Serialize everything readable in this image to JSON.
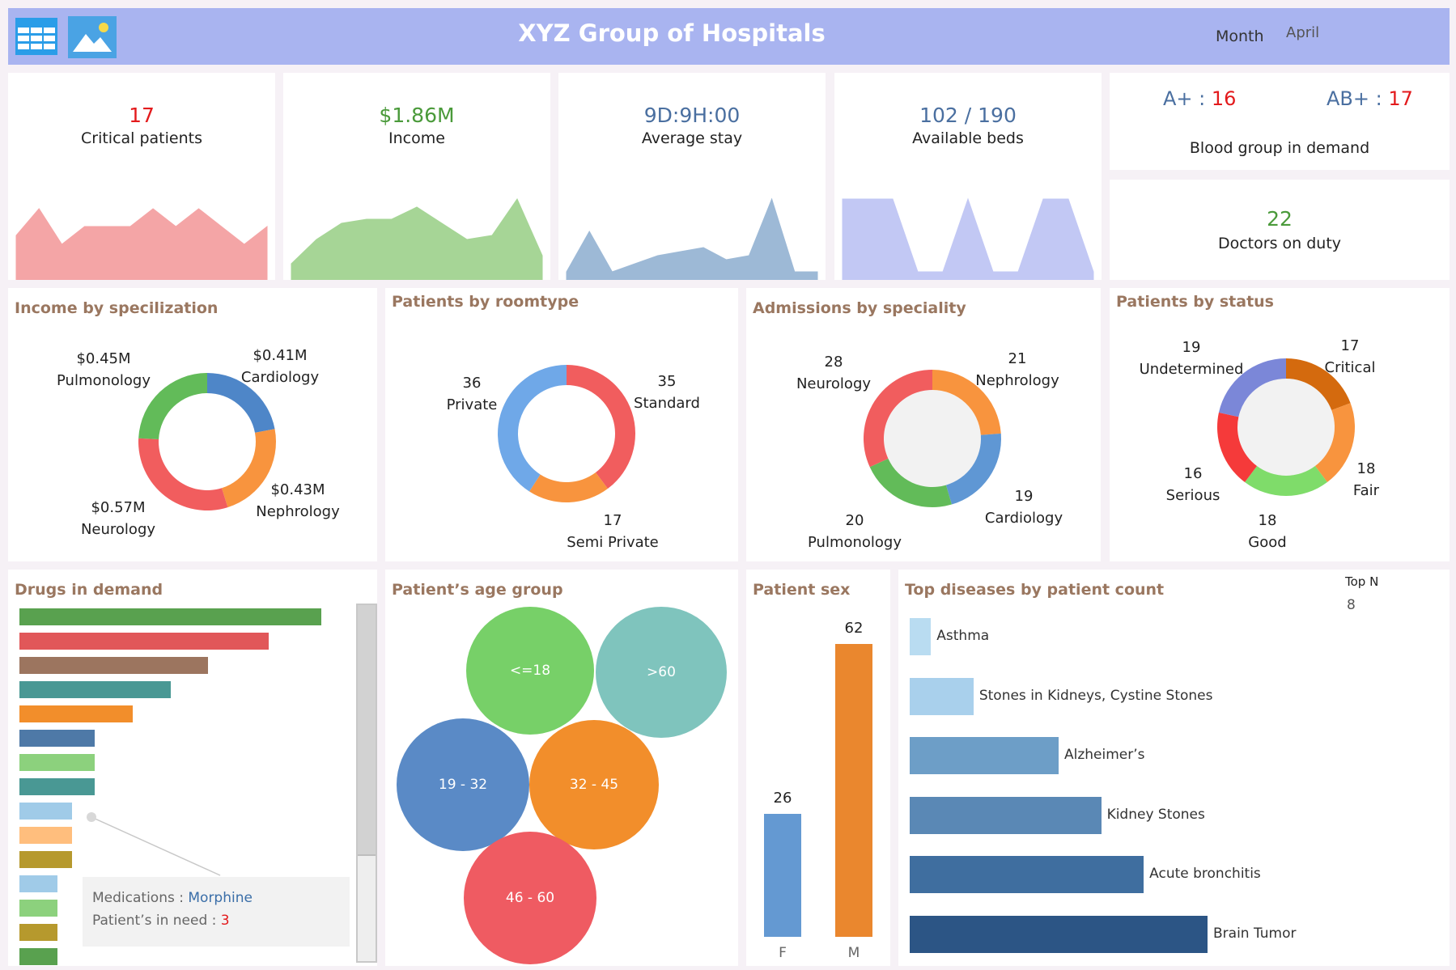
{
  "header": {
    "title": "XYZ Group of Hospitals",
    "month_label": "Month",
    "month_value": "April"
  },
  "kpis": {
    "critical": {
      "value": "17",
      "label": "Critical patients",
      "color": "#e31a1c",
      "area_color": "#f4a5a6"
    },
    "income": {
      "value": "$1.86M",
      "label": "Income",
      "color": "#4a9a3a",
      "area_color": "#a6d596"
    },
    "stay": {
      "value": "9D:9H:00",
      "label": "Average stay",
      "color": "#4a6fa0",
      "area_color": "#9db9d6"
    },
    "beds": {
      "value": "102 / 190",
      "label": "Available beds",
      "color": "#4a6fa0",
      "area_color": "#c2c8f4"
    },
    "blood": {
      "label": "Blood group in demand",
      "a_pos_label": "A+",
      "a_pos_value": "16",
      "ab_pos_label": "AB+",
      "ab_pos_value": "17",
      "label_color": "#4a6fa0",
      "value_color": "#e31a1c"
    },
    "doctors": {
      "value": "22",
      "label": "Doctors on duty",
      "color": "#4a9a3a"
    }
  },
  "panels": {
    "income_spec": "Income by specilization",
    "roomtype": "Patients by roomtype",
    "admissions": "Admissions by speciality",
    "status": "Patients by status",
    "drugs": "Drugs in demand",
    "age": "Patient’s age group",
    "sex": "Patient sex",
    "diseases": "Top diseases by patient count",
    "top_n_label": "Top N",
    "top_n_value": "8"
  },
  "income_spec": {
    "pulmonology": {
      "value": "$0.45M",
      "name": "Pulmonology"
    },
    "cardiology": {
      "value": "$0.41M",
      "name": "Cardiology"
    },
    "nephrology": {
      "value": "$0.43M",
      "name": "Nephrology"
    },
    "neurology": {
      "value": "$0.57M",
      "name": "Neurology"
    }
  },
  "roomtype": {
    "private": {
      "value": "36",
      "name": "Private"
    },
    "standard": {
      "value": "35",
      "name": "Standard"
    },
    "semi": {
      "value": "17",
      "name": "Semi Private"
    }
  },
  "admissions": {
    "neurology": {
      "value": "28",
      "name": "Neurology"
    },
    "nephrology": {
      "value": "21",
      "name": "Nephrology"
    },
    "cardiology": {
      "value": "19",
      "name": "Cardiology"
    },
    "pulmonology": {
      "value": "20",
      "name": "Pulmonology"
    }
  },
  "status": {
    "undetermined": {
      "value": "19",
      "name": "Undetermined"
    },
    "critical": {
      "value": "17",
      "name": "Critical"
    },
    "fair": {
      "value": "18",
      "name": "Fair"
    },
    "good": {
      "value": "18",
      "name": "Good"
    },
    "serious": {
      "value": "16",
      "name": "Serious"
    }
  },
  "tooltip": {
    "med_label": "Medications : ",
    "med_value": "Morphine",
    "need_label": "Patient’s in need : ",
    "need_value": "3"
  },
  "age_groups": [
    "<=18",
    ">60",
    "19 - 32",
    "32 - 45",
    "46 - 60"
  ],
  "chart_data": [
    {
      "type": "area",
      "title": "Critical patients trend",
      "values": [
        5,
        8,
        4,
        6,
        6,
        6,
        8,
        6,
        8,
        6,
        4,
        6
      ],
      "ylim": [
        0,
        10
      ],
      "color": "#f4a5a6"
    },
    {
      "type": "area",
      "title": "Income trend",
      "values": [
        2,
        5,
        7,
        7.5,
        7.5,
        9,
        7,
        5,
        5.5,
        10,
        3
      ],
      "ylim": [
        0,
        11
      ],
      "color": "#a6d596"
    },
    {
      "type": "area",
      "title": "Average stay trend",
      "values": [
        1,
        6,
        1,
        2,
        3,
        3.5,
        4,
        2.5,
        3,
        10,
        1,
        1
      ],
      "ylim": [
        0,
        11
      ],
      "color": "#9db9d6"
    },
    {
      "type": "area",
      "title": "Available beds trend",
      "values": [
        10,
        10,
        10,
        1,
        1,
        10,
        1,
        1,
        10,
        10,
        1
      ],
      "ylim": [
        0,
        11
      ],
      "color": "#c2c8f4"
    },
    {
      "type": "pie",
      "title": "Income by specilization",
      "categories": [
        "Cardiology",
        "Nephrology",
        "Neurology",
        "Pulmonology"
      ],
      "values": [
        0.41,
        0.43,
        0.57,
        0.45
      ],
      "colors": [
        "#4e86c8",
        "#f8943e",
        "#f15d5e",
        "#62bb59"
      ]
    },
    {
      "type": "pie",
      "title": "Patients by roomtype",
      "categories": [
        "Standard",
        "Semi Private",
        "Private"
      ],
      "values": [
        35,
        17,
        36
      ],
      "colors": [
        "#f15d5e",
        "#f8943e",
        "#6fa8e8"
      ]
    },
    {
      "type": "pie",
      "title": "Admissions by speciality",
      "categories": [
        "Nephrology",
        "Cardiology",
        "Pulmonology",
        "Neurology"
      ],
      "values": [
        21,
        19,
        20,
        28
      ],
      "colors": [
        "#f8943e",
        "#5f97d4",
        "#62bb59",
        "#f15d5e"
      ]
    },
    {
      "type": "pie",
      "title": "Patients by status",
      "categories": [
        "Critical",
        "Fair",
        "Good",
        "Serious",
        "Undetermined"
      ],
      "values": [
        17,
        18,
        18,
        16,
        19
      ],
      "colors": [
        "#d46a0e",
        "#f8943e",
        "#7fdc6a",
        "#f53a3a",
        "#7b87d8"
      ]
    },
    {
      "type": "bar",
      "title": "Drugs in demand",
      "values": [
        40,
        33,
        25,
        20,
        15,
        10,
        10,
        10,
        7,
        7,
        7,
        5,
        5,
        5,
        5
      ],
      "xlim": [
        0,
        42
      ],
      "colors": [
        "#59a14f",
        "#e15759",
        "#9c755f",
        "#499894",
        "#f28e2b",
        "#4e79a7",
        "#8cd17d",
        "#499894",
        "#a0cbe8",
        "#ffbe7d",
        "#b6992d",
        "#a0cbe8",
        "#8cd17d",
        "#b6992d",
        "#59a14f"
      ]
    },
    {
      "type": "bar",
      "title": "Patient sex",
      "categories": [
        "F",
        "M"
      ],
      "values": [
        26,
        62
      ],
      "ylim": [
        0,
        62
      ],
      "colors": [
        "#6499d2",
        "#ea872e"
      ]
    },
    {
      "type": "bar",
      "title": "Top diseases by patient count",
      "categories": [
        "Asthma",
        "Stones in Kidneys, Cystine Stones",
        "Alzheimer’s",
        "Kidney Stones",
        "Acute bronchitis",
        "Brain Tumor"
      ],
      "values": [
        1,
        3,
        7,
        9,
        11,
        14
      ],
      "xlim": [
        0,
        14
      ],
      "colors": [
        "#b9dcf1",
        "#a9d0ec",
        "#6d9ec7",
        "#5a88b5",
        "#3f6e9f",
        "#2c5585"
      ]
    }
  ]
}
